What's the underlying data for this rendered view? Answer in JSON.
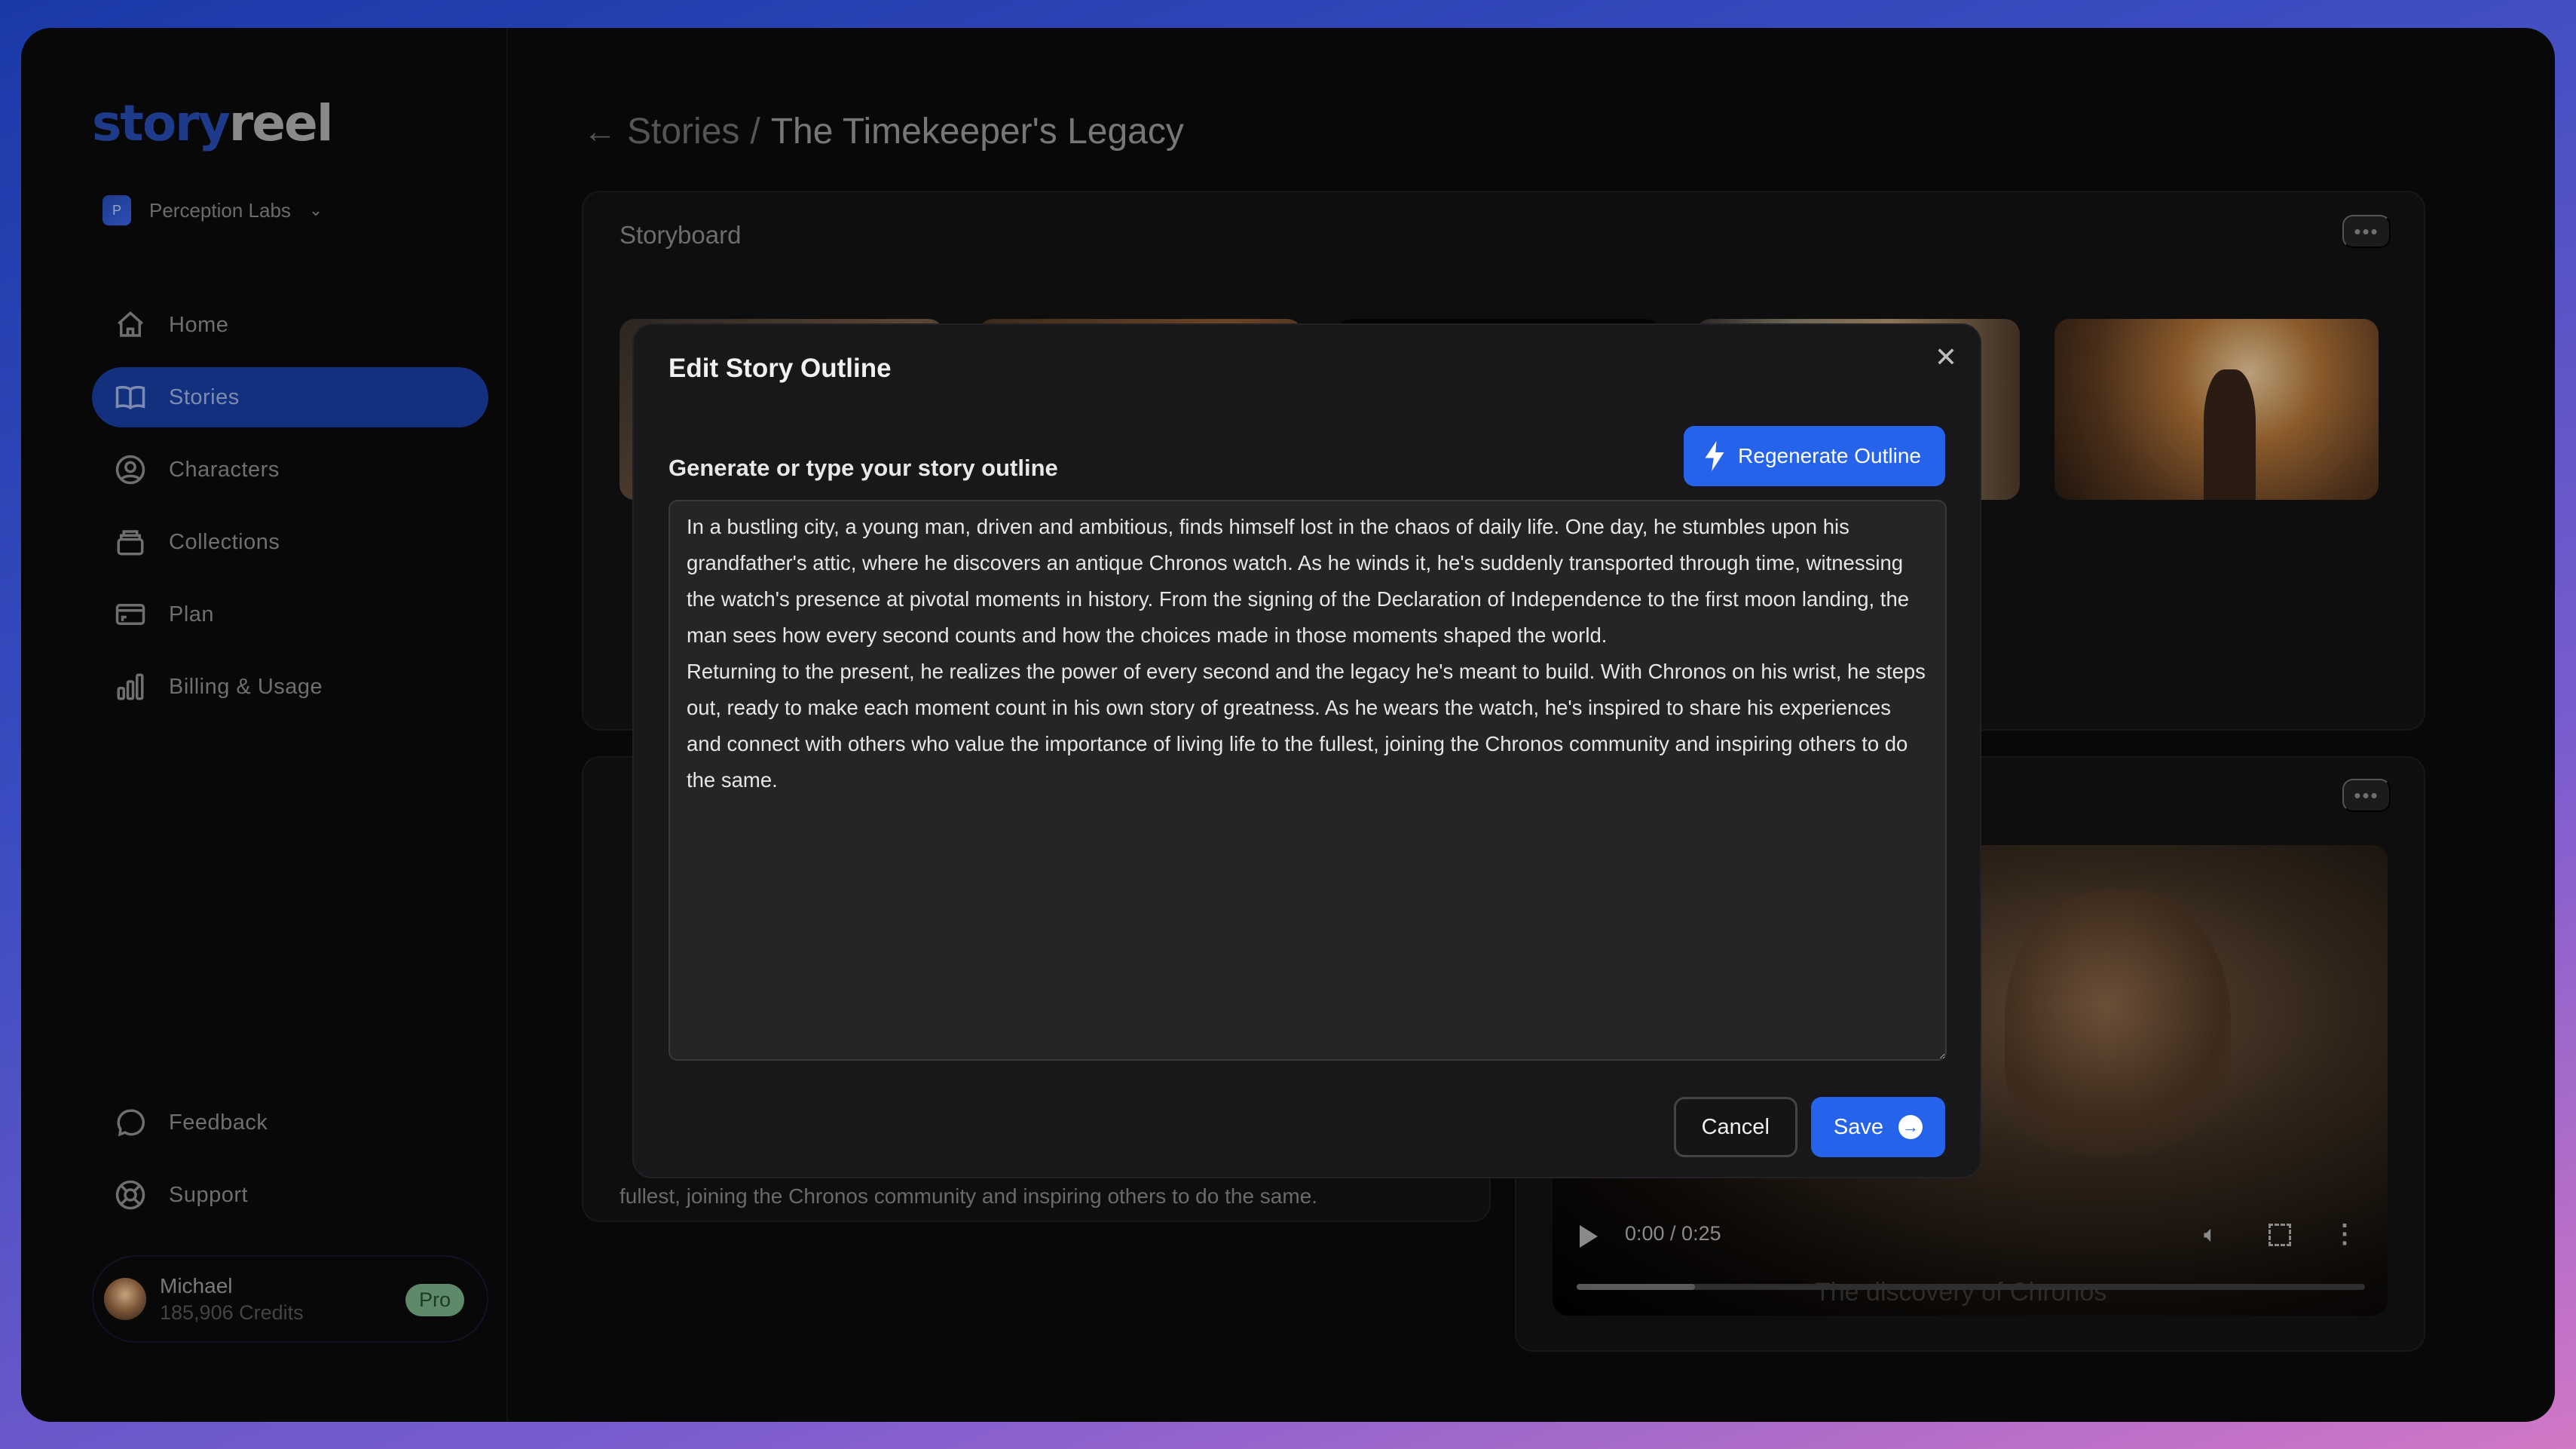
{
  "brand": {
    "logo_part1": "story",
    "logo_part2": "reel"
  },
  "org": {
    "initial": "P",
    "name": "Perception Labs"
  },
  "sidebar": {
    "items": [
      {
        "label": "Home",
        "icon": "home-icon",
        "active": false
      },
      {
        "label": "Stories",
        "icon": "book-open-icon",
        "active": true
      },
      {
        "label": "Characters",
        "icon": "user-circle-icon",
        "active": false
      },
      {
        "label": "Collections",
        "icon": "stack-icon",
        "active": false
      },
      {
        "label": "Plan",
        "icon": "credit-card-icon",
        "active": false
      },
      {
        "label": "Billing & Usage",
        "icon": "bar-chart-icon",
        "active": false
      }
    ],
    "bottom_items": [
      {
        "label": "Feedback",
        "icon": "chat-bubble-icon"
      },
      {
        "label": "Support",
        "icon": "lifebuoy-icon"
      }
    ]
  },
  "user": {
    "name": "Michael",
    "credits": "185,906 Credits",
    "plan_badge": "Pro"
  },
  "header": {
    "back_icon": "arrow-left-icon",
    "parent": "Stories",
    "separator": "/",
    "current": "The Timekeeper's Legacy"
  },
  "storyboard": {
    "title": "Storyboard",
    "menu_icon": "ellipsis-icon",
    "thumbnail_count": 5
  },
  "outline_card": {
    "visible_text": "fullest, joining the Chronos community and inspiring others to do the same."
  },
  "video": {
    "time": "0:00 / 0:25",
    "caption": "The discovery of Chronos",
    "progress_fraction": 0.15
  },
  "modal": {
    "title": "Edit Story Outline",
    "close_icon": "close-icon",
    "field_label": "Generate or type your story outline",
    "regenerate_label": "Regenerate Outline",
    "outline_text": "In a bustling city, a young man, driven and ambitious, finds himself lost in the chaos of daily life. One day, he stumbles upon his grandfather's attic, where he discovers an antique Chronos watch. As he winds it, he's suddenly transported through time, witnessing the watch's presence at pivotal moments in history. From the signing of the Declaration of Independence to the first moon landing, the man sees how every second counts and how the choices made in those moments shaped the world.\nReturning to the present, he realizes the power of every second and the legacy he's meant to build. With Chronos on his wrist, he steps out, ready to make each moment count in his own story of greatness. As he wears the watch, he's inspired to share his experiences and connect with others who value the importance of living life to the fullest, joining the Chronos community and inspiring others to do the same.",
    "cancel_label": "Cancel",
    "save_label": "Save"
  },
  "colors": {
    "accent": "#2563eb",
    "active_nav": "#12307d",
    "pro_badge": "#5e8a6a",
    "app_bg": "#080808",
    "modal_bg": "#18181b"
  }
}
